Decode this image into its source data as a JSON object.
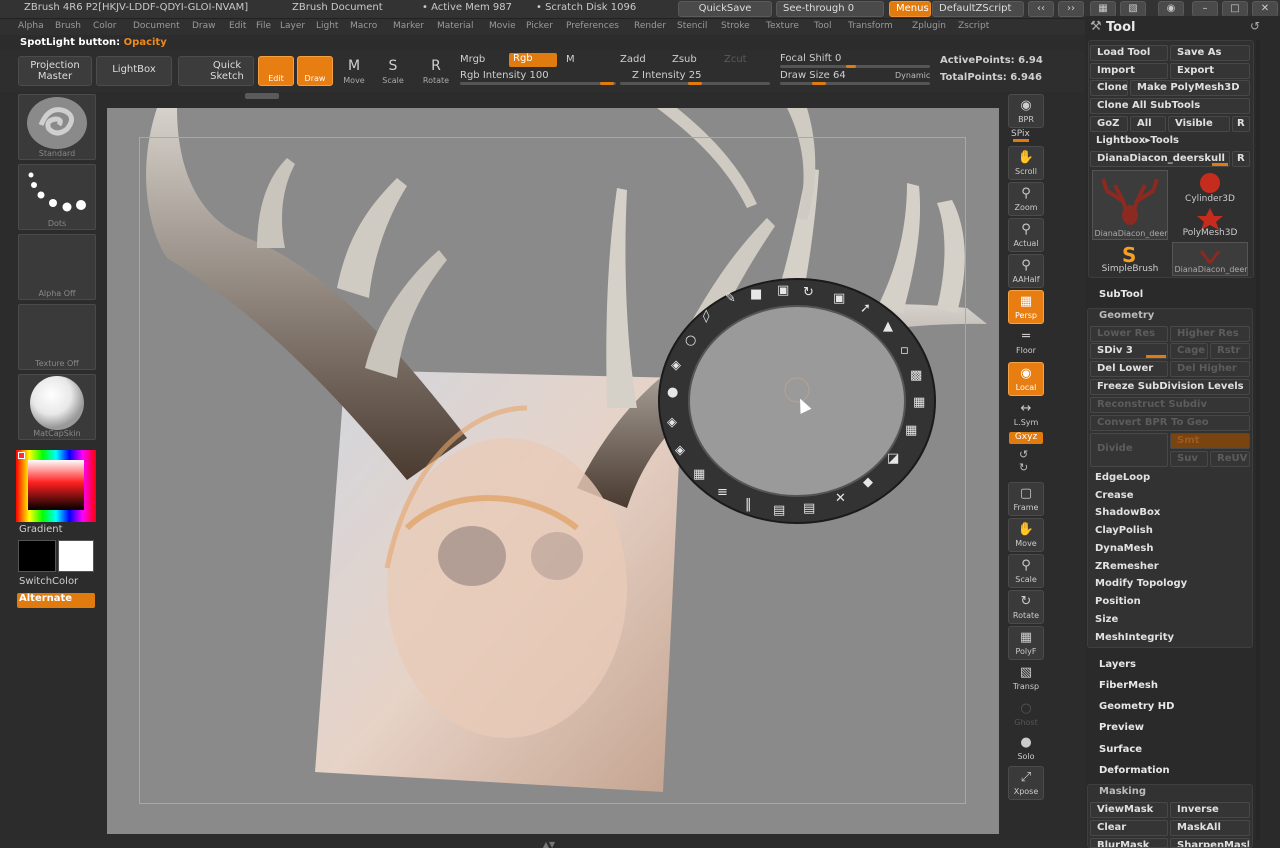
{
  "titlebar": {
    "app": "ZBrush 4R6  P2[HKJV-LDDF-QDYI-GLOI-NVAM]",
    "document": "ZBrush Document",
    "active_mem": "• Active Mem 987",
    "scratch_disk": "• Scratch Disk 1096",
    "quicksave": "QuickSave",
    "seethrough": "See-through  0",
    "menus": "Menus",
    "defaultscript": "DefaultZScript"
  },
  "menubar": [
    "Alpha",
    "Brush",
    "Color",
    "Document",
    "Draw",
    "Edit",
    "File",
    "Layer",
    "Light",
    "Macro",
    "Marker",
    "Material",
    "Movie",
    "Picker",
    "Preferences",
    "Render",
    "Stencil",
    "Stroke",
    "Texture",
    "Tool",
    "Transform",
    "Zplugin",
    "Zscript"
  ],
  "status": {
    "label": "SpotLight button:",
    "value": "Opacity"
  },
  "shelf": {
    "projection_master": "Projection Master",
    "lightbox": "LightBox",
    "quick_sketch": "Quick Sketch",
    "edit": "Edit",
    "draw": "Draw",
    "move": "Move",
    "scale": "Scale",
    "rotate": "Rotate",
    "mrgb": "Mrgb",
    "rgb": "Rgb",
    "m": "M",
    "rgb_intensity": "Rgb  Intensity 100",
    "zadd": "Zadd",
    "zsub": "Zsub",
    "zcut": "Zcut",
    "z_intensity": "Z Intensity 25",
    "focal_shift": "Focal  Shift 0",
    "draw_size": "Draw  Size 64",
    "dynamic": "Dynamic",
    "active_points": "ActivePoints: 6.94",
    "total_points": "TotalPoints: 6.946"
  },
  "left_tray": {
    "brush": "Standard",
    "stroke": "Dots",
    "alpha": "Alpha  Off",
    "texture": "Texture  Off",
    "material": "MatCapSkin",
    "gradient": "Gradient",
    "switchcolor": "SwitchColor",
    "alternate": "Alternate",
    "colors": {
      "main": "#ffffff",
      "secondary": "#000000",
      "accent": "#e07b10"
    }
  },
  "right_tray": [
    {
      "name": "bpr",
      "label": "BPR",
      "icon": "render-icon"
    },
    {
      "name": "spix",
      "label": "SPix",
      "icon": "slider-icon"
    },
    {
      "name": "scroll",
      "label": "Scroll",
      "icon": "hand-icon"
    },
    {
      "name": "zoom",
      "label": "Zoom",
      "icon": "magnifier-icon"
    },
    {
      "name": "actual",
      "label": "Actual",
      "icon": "magnifier-icon"
    },
    {
      "name": "aahalf",
      "label": "AAHalf",
      "icon": "magnifier-icon"
    },
    {
      "name": "persp",
      "label": "Persp",
      "icon": "grid-icon"
    },
    {
      "name": "floor",
      "label": "Floor",
      "icon": "floor-icon"
    },
    {
      "name": "local",
      "label": "Local",
      "icon": "local-icon"
    },
    {
      "name": "lsym",
      "label": "L.Sym",
      "icon": "symmetry-icon"
    },
    {
      "name": "xyz",
      "label": "Gxyz",
      "icon": "axis-icon"
    },
    {
      "name": "frame",
      "label": "Frame",
      "icon": "frame-icon"
    },
    {
      "name": "move",
      "label": "Move",
      "icon": "hand-icon"
    },
    {
      "name": "scale",
      "label": "Scale",
      "icon": "scale-icon"
    },
    {
      "name": "rotate",
      "label": "Rotate",
      "icon": "rotate-icon"
    },
    {
      "name": "polyf",
      "label": "PolyF",
      "icon": "polyframe-icon"
    },
    {
      "name": "transp",
      "label": "Transp",
      "icon": "transparency-icon"
    },
    {
      "name": "ghost",
      "label": "Ghost",
      "icon": "ghost-icon"
    },
    {
      "name": "solo",
      "label": "Solo",
      "icon": "solo-icon"
    },
    {
      "name": "xpose",
      "label": "Xpose",
      "icon": "xpose-icon"
    }
  ],
  "tool": {
    "title": "Tool",
    "load_tool": "Load Tool",
    "save_as": "Save As",
    "import": "Import",
    "export": "Export",
    "clone": "Clone",
    "make_polymesh": "Make PolyMesh3D",
    "clone_all": "Clone  All  SubTools",
    "goz": "GoZ",
    "all": "All",
    "visible": "Visible",
    "r": "R",
    "lightbox_tools": "Lightbox▸Tools",
    "current_tool": "DianaDiacon_deerskull",
    "tools": [
      "DianaDiacon_deer",
      "Cylinder3D",
      "PolyMesh3D",
      "SimpleBrush",
      "DianaDiacon_deer"
    ],
    "subtool": "SubTool",
    "geometry": "Geometry",
    "lower_res": "Lower  Res",
    "higher_res": "Higher  Res",
    "sdiv": "SDiv 3",
    "cage": "Cage",
    "rstr": "Rstr",
    "del_lower": "Del Lower",
    "del_higher": "Del Higher",
    "freeze": "Freeze  SubDivision  Levels",
    "reconstruct": "Reconstruct  Subdiv",
    "convert_bpr": "Convert  BPR  To  Geo",
    "divide": "Divide",
    "smt": "Smt",
    "suv": "Suv",
    "reuv": "ReUV",
    "items": [
      "EdgeLoop",
      "Crease",
      "ShadowBox",
      "ClayPolish",
      "DynaMesh",
      "ZRemesher",
      "Modify Topology",
      "Position",
      "Size",
      "MeshIntegrity"
    ],
    "sections": [
      "Layers",
      "FiberMesh",
      "Geometry HD",
      "Preview",
      "Surface",
      "Deformation"
    ],
    "masking": "Masking",
    "viewmask": "ViewMask",
    "inverse": "Inverse",
    "clear": "Clear",
    "maskall": "MaskAll",
    "blurmask": "BlurMask",
    "sharpenmask": "SharpenMask"
  }
}
